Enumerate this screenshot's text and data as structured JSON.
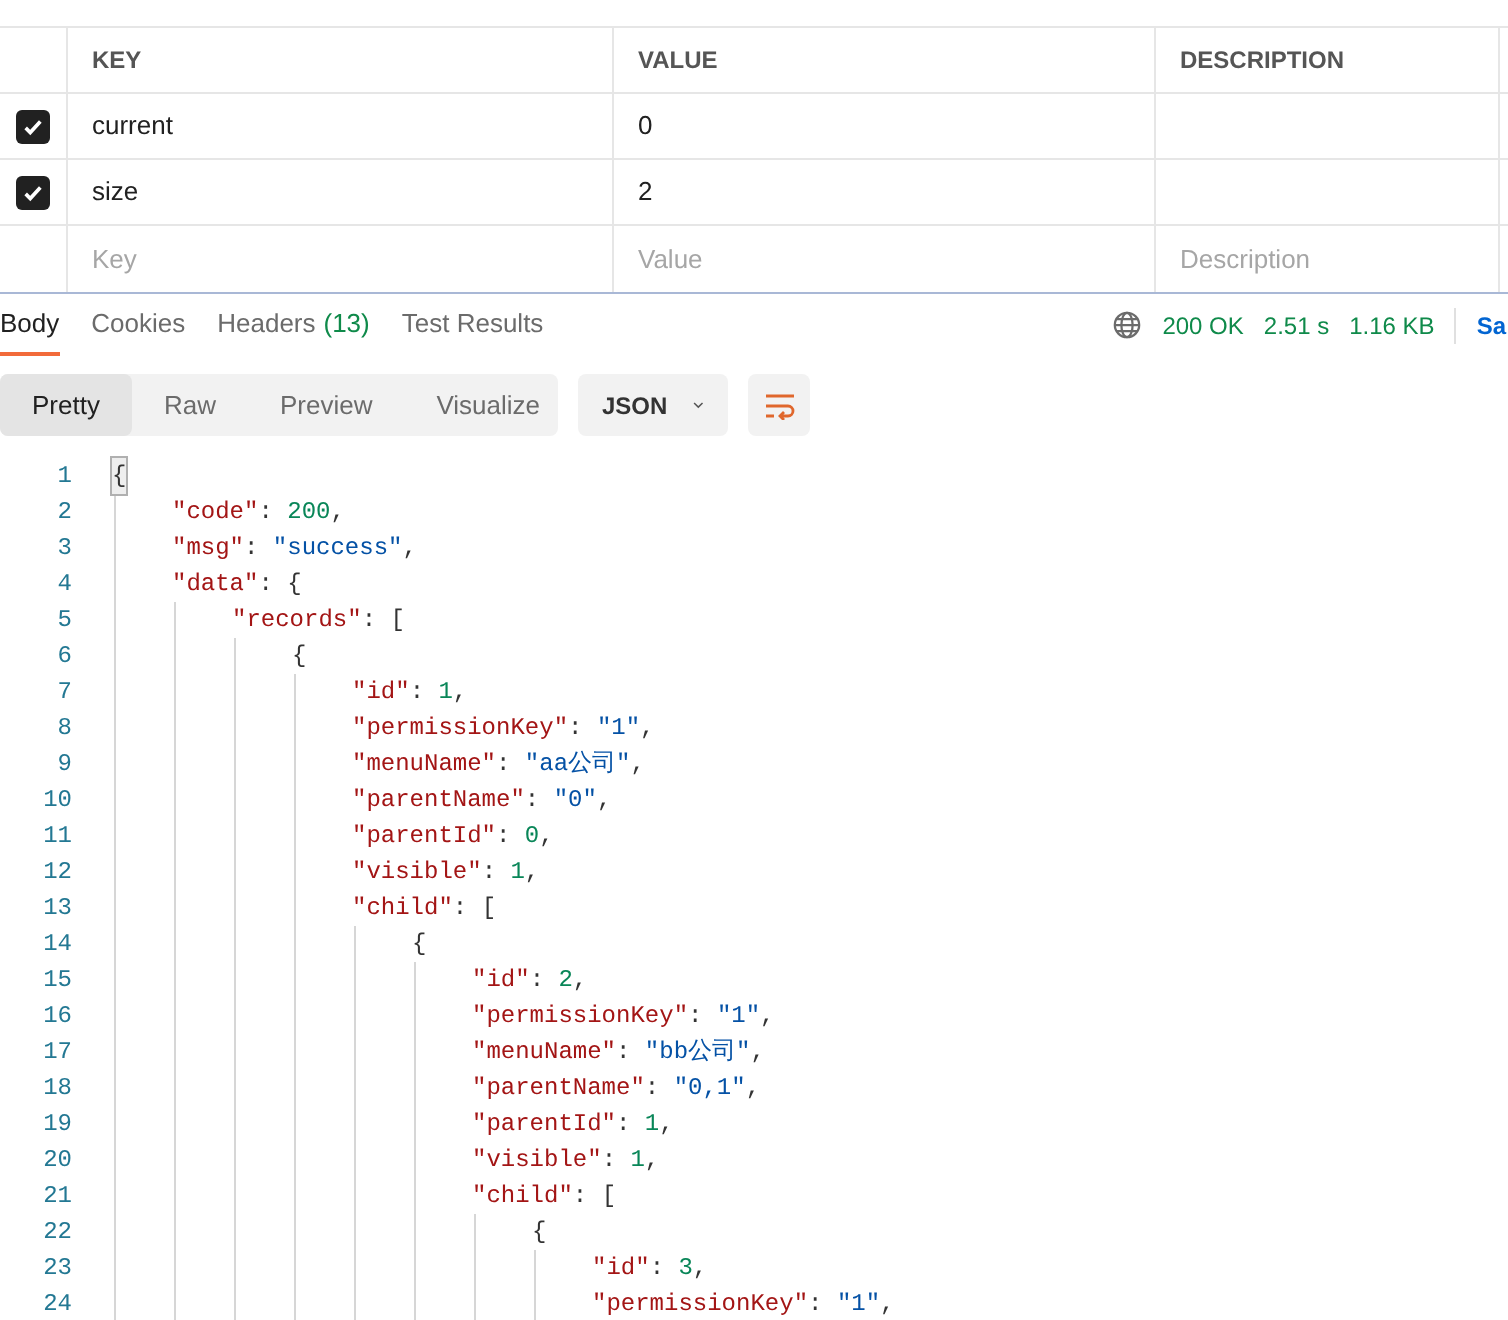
{
  "params_table": {
    "columns": [
      "KEY",
      "VALUE",
      "DESCRIPTION"
    ],
    "rows": [
      {
        "checked": true,
        "key": "current",
        "value": "0"
      },
      {
        "checked": true,
        "key": "size",
        "value": "2"
      }
    ],
    "new_row": {
      "key_placeholder": "Key",
      "value_placeholder": "Value",
      "description_placeholder": "Description"
    }
  },
  "response_tabs": [
    {
      "label": "Body",
      "selected": true
    },
    {
      "label": "Cookies",
      "selected": false
    },
    {
      "label": "Headers",
      "count": "(13)",
      "selected": false
    },
    {
      "label": "Test Results",
      "selected": false
    }
  ],
  "status": {
    "code": "200 OK",
    "time": "2.51 s",
    "size": "1.16 KB",
    "save_label": "Sa"
  },
  "view_modes": [
    {
      "label": "Pretty",
      "selected": true
    },
    {
      "label": "Raw",
      "selected": false
    },
    {
      "label": "Preview",
      "selected": false
    },
    {
      "label": "Visualize",
      "selected": false
    }
  ],
  "format": "JSON",
  "code": [
    {
      "number": "1",
      "highlighted": true,
      "tokens": [
        {
          "kind": "punct",
          "text": "{"
        }
      ],
      "children": [
        {
          "number": "2",
          "tokens": [
            {
              "kind": "key",
              "text": "\"code\""
            },
            {
              "kind": "punct",
              "text": ": "
            },
            {
              "kind": "number",
              "text": "200"
            },
            {
              "kind": "punct",
              "text": ","
            }
          ]
        },
        {
          "number": "3",
          "tokens": [
            {
              "kind": "key",
              "text": "\"msg\""
            },
            {
              "kind": "punct",
              "text": ": "
            },
            {
              "kind": "string",
              "text": "\"success\""
            },
            {
              "kind": "punct",
              "text": ","
            }
          ]
        },
        {
          "number": "4",
          "tokens": [
            {
              "kind": "key",
              "text": "\"data\""
            },
            {
              "kind": "punct",
              "text": ": {"
            }
          ],
          "children": [
            {
              "number": "5",
              "tokens": [
                {
                  "kind": "key",
                  "text": "\"records\""
                },
                {
                  "kind": "punct",
                  "text": ": ["
                }
              ],
              "children": [
                {
                  "number": "6",
                  "tokens": [
                    {
                      "kind": "punct",
                      "text": "{"
                    }
                  ],
                  "children": [
                    {
                      "number": "7",
                      "tokens": [
                        {
                          "kind": "key",
                          "text": "\"id\""
                        },
                        {
                          "kind": "punct",
                          "text": ": "
                        },
                        {
                          "kind": "number",
                          "text": "1"
                        },
                        {
                          "kind": "punct",
                          "text": ","
                        }
                      ]
                    },
                    {
                      "number": "8",
                      "tokens": [
                        {
                          "kind": "key",
                          "text": "\"permissionKey\""
                        },
                        {
                          "kind": "punct",
                          "text": ": "
                        },
                        {
                          "kind": "string",
                          "text": "\"1\""
                        },
                        {
                          "kind": "punct",
                          "text": ","
                        }
                      ]
                    },
                    {
                      "number": "9",
                      "tokens": [
                        {
                          "kind": "key",
                          "text": "\"menuName\""
                        },
                        {
                          "kind": "punct",
                          "text": ": "
                        },
                        {
                          "kind": "string",
                          "text": "\"aa公司\""
                        },
                        {
                          "kind": "punct",
                          "text": ","
                        }
                      ]
                    },
                    {
                      "number": "10",
                      "tokens": [
                        {
                          "kind": "key",
                          "text": "\"parentName\""
                        },
                        {
                          "kind": "punct",
                          "text": ": "
                        },
                        {
                          "kind": "string",
                          "text": "\"0\""
                        },
                        {
                          "kind": "punct",
                          "text": ","
                        }
                      ]
                    },
                    {
                      "number": "11",
                      "tokens": [
                        {
                          "kind": "key",
                          "text": "\"parentId\""
                        },
                        {
                          "kind": "punct",
                          "text": ": "
                        },
                        {
                          "kind": "number",
                          "text": "0"
                        },
                        {
                          "kind": "punct",
                          "text": ","
                        }
                      ]
                    },
                    {
                      "number": "12",
                      "tokens": [
                        {
                          "kind": "key",
                          "text": "\"visible\""
                        },
                        {
                          "kind": "punct",
                          "text": ": "
                        },
                        {
                          "kind": "number",
                          "text": "1"
                        },
                        {
                          "kind": "punct",
                          "text": ","
                        }
                      ]
                    },
                    {
                      "number": "13",
                      "tokens": [
                        {
                          "kind": "key",
                          "text": "\"child\""
                        },
                        {
                          "kind": "punct",
                          "text": ": ["
                        }
                      ],
                      "children": [
                        {
                          "number": "14",
                          "tokens": [
                            {
                              "kind": "punct",
                              "text": "{"
                            }
                          ],
                          "children": [
                            {
                              "number": "15",
                              "tokens": [
                                {
                                  "kind": "key",
                                  "text": "\"id\""
                                },
                                {
                                  "kind": "punct",
                                  "text": ": "
                                },
                                {
                                  "kind": "number",
                                  "text": "2"
                                },
                                {
                                  "kind": "punct",
                                  "text": ","
                                }
                              ]
                            },
                            {
                              "number": "16",
                              "tokens": [
                                {
                                  "kind": "key",
                                  "text": "\"permissionKey\""
                                },
                                {
                                  "kind": "punct",
                                  "text": ": "
                                },
                                {
                                  "kind": "string",
                                  "text": "\"1\""
                                },
                                {
                                  "kind": "punct",
                                  "text": ","
                                }
                              ]
                            },
                            {
                              "number": "17",
                              "tokens": [
                                {
                                  "kind": "key",
                                  "text": "\"menuName\""
                                },
                                {
                                  "kind": "punct",
                                  "text": ": "
                                },
                                {
                                  "kind": "string",
                                  "text": "\"bb公司\""
                                },
                                {
                                  "kind": "punct",
                                  "text": ","
                                }
                              ]
                            },
                            {
                              "number": "18",
                              "tokens": [
                                {
                                  "kind": "key",
                                  "text": "\"parentName\""
                                },
                                {
                                  "kind": "punct",
                                  "text": ": "
                                },
                                {
                                  "kind": "string",
                                  "text": "\"0,1\""
                                },
                                {
                                  "kind": "punct",
                                  "text": ","
                                }
                              ]
                            },
                            {
                              "number": "19",
                              "tokens": [
                                {
                                  "kind": "key",
                                  "text": "\"parentId\""
                                },
                                {
                                  "kind": "punct",
                                  "text": ": "
                                },
                                {
                                  "kind": "number",
                                  "text": "1"
                                },
                                {
                                  "kind": "punct",
                                  "text": ","
                                }
                              ]
                            },
                            {
                              "number": "20",
                              "tokens": [
                                {
                                  "kind": "key",
                                  "text": "\"visible\""
                                },
                                {
                                  "kind": "punct",
                                  "text": ": "
                                },
                                {
                                  "kind": "number",
                                  "text": "1"
                                },
                                {
                                  "kind": "punct",
                                  "text": ","
                                }
                              ]
                            },
                            {
                              "number": "21",
                              "tokens": [
                                {
                                  "kind": "key",
                                  "text": "\"child\""
                                },
                                {
                                  "kind": "punct",
                                  "text": ": ["
                                }
                              ],
                              "children": [
                                {
                                  "number": "22",
                                  "tokens": [
                                    {
                                      "kind": "punct",
                                      "text": "{"
                                    }
                                  ],
                                  "children": [
                                    {
                                      "number": "23",
                                      "tokens": [
                                        {
                                          "kind": "key",
                                          "text": "\"id\""
                                        },
                                        {
                                          "kind": "punct",
                                          "text": ": "
                                        },
                                        {
                                          "kind": "number",
                                          "text": "3"
                                        },
                                        {
                                          "kind": "punct",
                                          "text": ","
                                        }
                                      ]
                                    },
                                    {
                                      "number": "24",
                                      "tokens": [
                                        {
                                          "kind": "key",
                                          "text": "\"permissionKey\""
                                        },
                                        {
                                          "kind": "punct",
                                          "text": ": "
                                        },
                                        {
                                          "kind": "string",
                                          "text": "\"1\""
                                        },
                                        {
                                          "kind": "punct",
                                          "text": ","
                                        }
                                      ]
                                    }
                                  ]
                                }
                              ]
                            }
                          ]
                        }
                      ]
                    }
                  ]
                }
              ]
            }
          ]
        }
      ]
    }
  ]
}
